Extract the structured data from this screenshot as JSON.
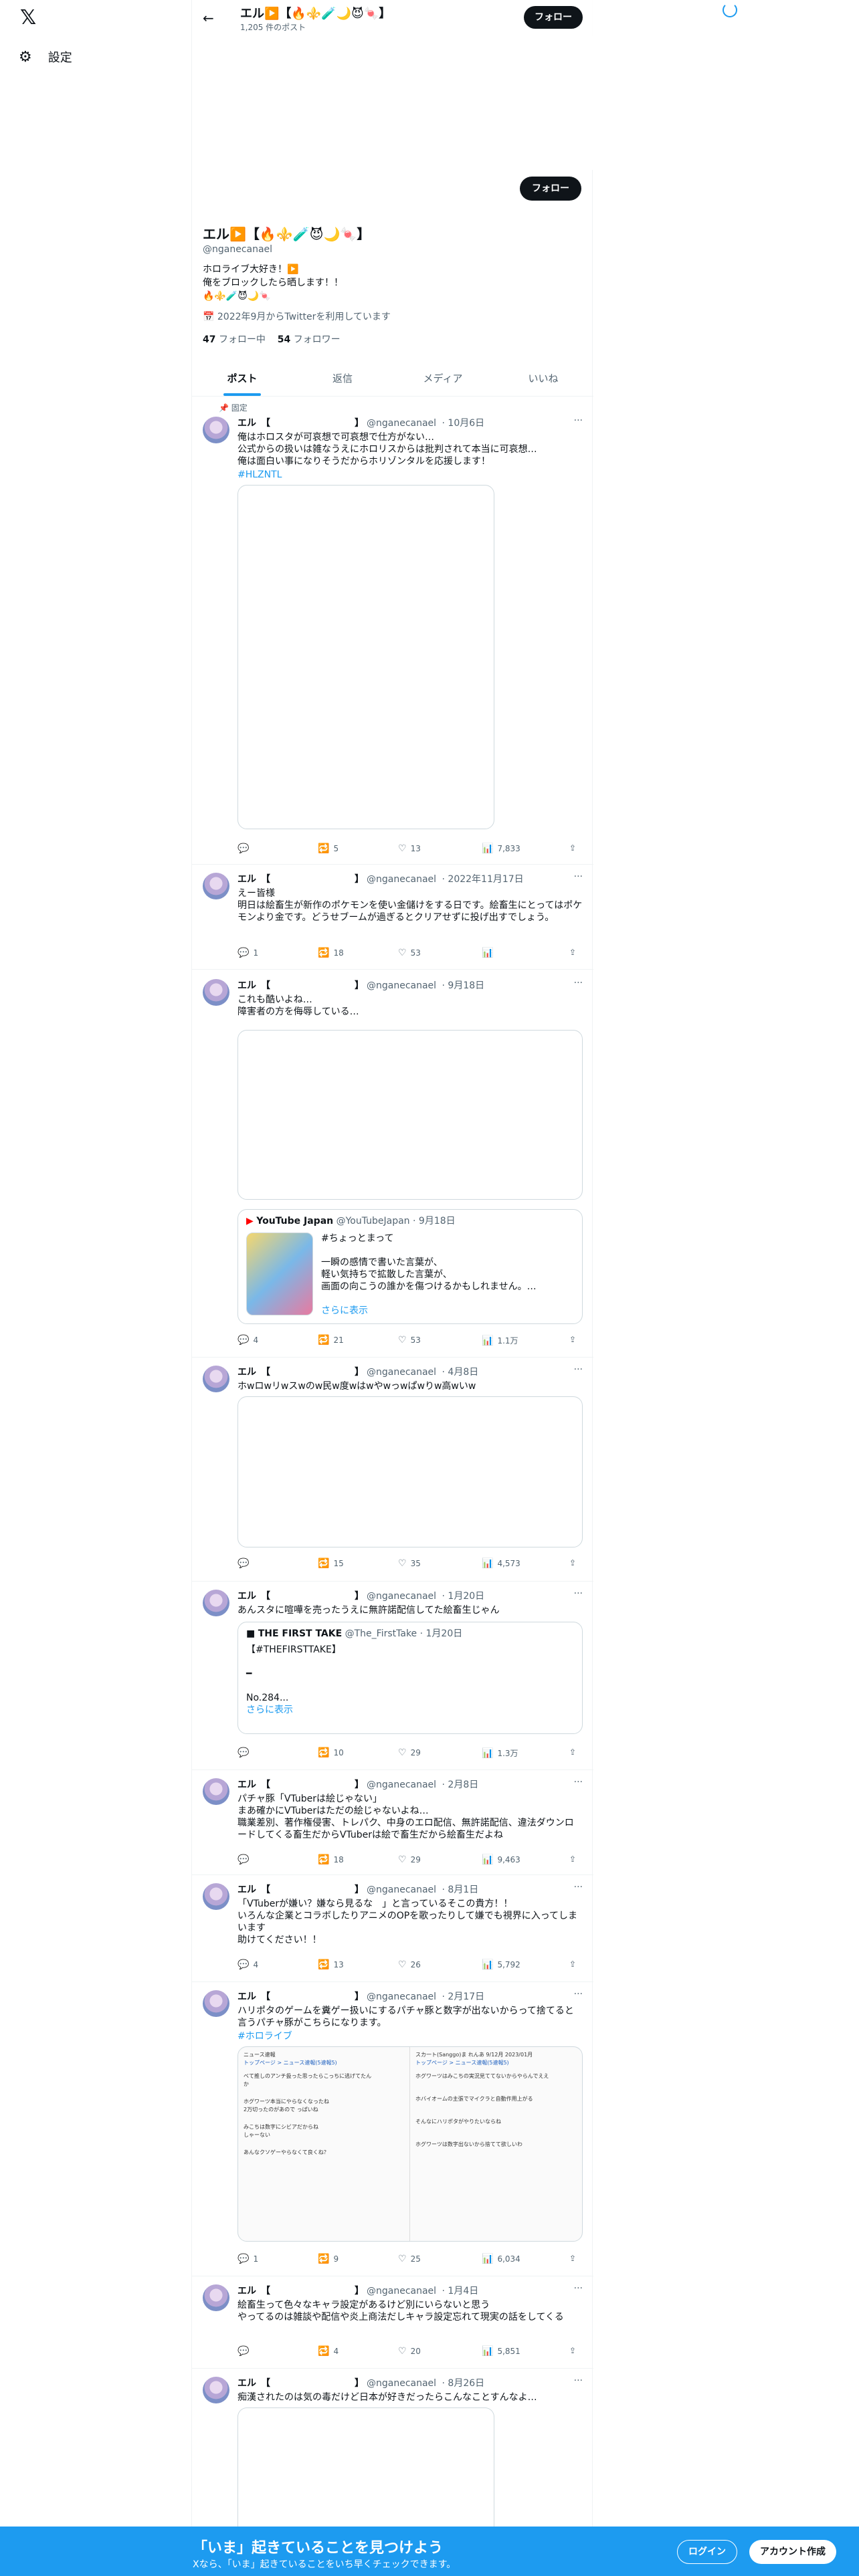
{
  "nav": {
    "logo": "𝕏",
    "settings": "設定"
  },
  "header": {
    "name": "エル▶️【🔥⚜️🧪🌙😈🍬】",
    "post_count": "1,205 件のポスト",
    "follow": "フォロー"
  },
  "profile": {
    "name": "エル▶️【🔥⚜️🧪😈🌙🍬】",
    "handle": "@nganecanael",
    "bio": "ホロライブ大好き！▶️\n俺をブロックしたら晒します！！\n🔥⚜️🧪😈🌙🍬",
    "joined": "2022年9月からTwitterを利用しています",
    "following_count": "47",
    "following_label": "フォロー中",
    "followers_count": "54",
    "followers_label": "フォロワー",
    "follow": "フォロー"
  },
  "tabs": [
    "ポスト",
    "返信",
    "メディア",
    "いいね"
  ],
  "tweets": [
    {
      "pinned": "📌 固定",
      "name": "エル　【　　　　　　　　　】",
      "handle": "@nganecanael",
      "date": "· 10月6日",
      "text": "俺はホロスタが可哀想で可哀想で仕方がない…\n公式からの扱いは雑なうえにホロリスからは批判されて本当に可哀想…\n俺は面白い事になりそうだからホリゾンタルを応援します！",
      "tag": "#HLZNTL",
      "reply": "",
      "repost": "5",
      "like": "13",
      "views": "7,833"
    },
    {
      "name": "エル　【　　　　　　　　　】",
      "handle": "@nganecanael",
      "date": "· 2022年11月17日",
      "text": "えー皆様\n明日は絵畜生が新作のポケモンを使い金儲けをする日です。絵畜生にとってはポケモンより金です。どうせブームが過ぎるとクリアせずに投げ出すでしょう。",
      "reply": "1",
      "repost": "18",
      "like": "53",
      "views": ""
    },
    {
      "name": "エル　【　　　　　　　　　】",
      "handle": "@nganecanael",
      "date": "· 9月18日",
      "text": "これも酷いよね…\n障害者の方を侮辱している…",
      "quote": {
        "name": "YouTube Japan",
        "handle": "@YouTubeJapan · 9月18日",
        "text": "#ちょっとまって\n\n一瞬の感情で書いた言葉が、\n軽い気持ちで拡散した言葉が、\n画面の向こうの誰かを傷つけるかもしれません。…",
        "more": "さらに表示"
      },
      "reply": "4",
      "repost": "21",
      "like": "53",
      "views": "1.1万"
    },
    {
      "name": "エル　【　　　　　　　　　】",
      "handle": "@nganecanael",
      "date": "· 4月8日",
      "text": "ホwロwリwスwのw民w度wはwやwっwぱwりw高wいw",
      "reply": "",
      "repost": "15",
      "like": "35",
      "views": "4,573"
    },
    {
      "name": "エル　【　　　　　　　　　】",
      "handle": "@nganecanael",
      "date": "· 1月20日",
      "text": "あんスタに喧嘩を売ったうえに無許諾配信してた絵畜生じゃん",
      "quote": {
        "name": "THE FIRST TAKE",
        "handle": "@The_FirstTake · 1月20日",
        "text": "【#THEFIRSTTAKE】\n\n━\n\nNo.284...",
        "more": "さらに表示"
      },
      "reply": "",
      "repost": "10",
      "like": "29",
      "views": "1.3万"
    },
    {
      "name": "エル　【　　　　　　　　　】",
      "handle": "@nganecanael",
      "date": "· 2月8日",
      "text": "パチャ豚「VTuberは絵じゃない」\nまあ確かにVTuberはただの絵じゃないよね…\n職業差別、著作権侵害、トレパク、中身のエロ配信、無許諾配信、違法ダウンロードしてくる畜生だからVTuberは絵で畜生だから絵畜生だよね",
      "reply": "",
      "repost": "18",
      "like": "29",
      "views": "9,463"
    },
    {
      "name": "エル　【　　　　　　　　　】",
      "handle": "@nganecanael",
      "date": "· 8月1日",
      "text": "「VTuberが嫌い？嫌なら見るな　」と言っているそこの貴方！！\nいろんな企業とコラボしたりアニメのOPを歌ったりして嫌でも視界に入ってしまいます\n助けてください！！",
      "reply": "4",
      "repost": "13",
      "like": "26",
      "views": "5,792"
    },
    {
      "name": "エル　【　　　　　　　　　】",
      "handle": "@nganecanael",
      "date": "· 2月17日",
      "text": "ハリポタのゲームを糞ゲー扱いにするパチャ豚と数字が出ないからって捨てると言うパチャ豚がこちらになります。",
      "tag": "#ホロライブ",
      "shot_left": [
        "ニュース速報",
        "トップページ > ニュース速報(5速報5)",
        "ベて推しのアンチ扱った思ったらこっちに逃げてたん",
        "か",
        "ホグワーツ本当にやらなくなったね",
        "2万切ったのがあので っぱいね",
        "みこちは数字にシビアだからね",
        "しゃーない",
        "あんなクソゲーやらなくて良くね？"
      ],
      "shot_right": [
        "スカ一ト(Sanggo)ま れんあ 9/12月 2023/01月",
        "トップページ > ニュース速報(5速報5)",
        "ホグワーツはみこちの実況見ててないからやらんでええ",
        "ホバイオームの主張でマイクラと自動作用上がる",
        "そんなにハリポタがやりたいならね",
        "ホグワーツは数字出ないから捨てて欲しいわ"
      ],
      "reply": "1",
      "repost": "9",
      "like": "25",
      "views": "6,034"
    },
    {
      "name": "エル　【　　　　　　　　　】",
      "handle": "@nganecanael",
      "date": "· 1月4日",
      "text": "絵畜生って色々なキャラ設定があるけど別にいらないと思う\nやってるのは雑談や配信や炎上商法だしキャラ設定忘れて現実の話をしてくる",
      "reply": "",
      "repost": "4",
      "like": "20",
      "views": "5,851"
    },
    {
      "name": "エル　【　　　　　　　　　】",
      "handle": "@nganecanael",
      "date": "· 8月26日",
      "text": "痴漢されたのは気の毒だけど日本が好きだったらこんなことすんなよ…"
    }
  ],
  "bottom": {
    "title": "「いま」起きていることを見つけよう",
    "subtitle": "Xなら、「いま」起きていることをいち早くチェックできます。",
    "login": "ログイン",
    "signup": "アカウント作成"
  }
}
